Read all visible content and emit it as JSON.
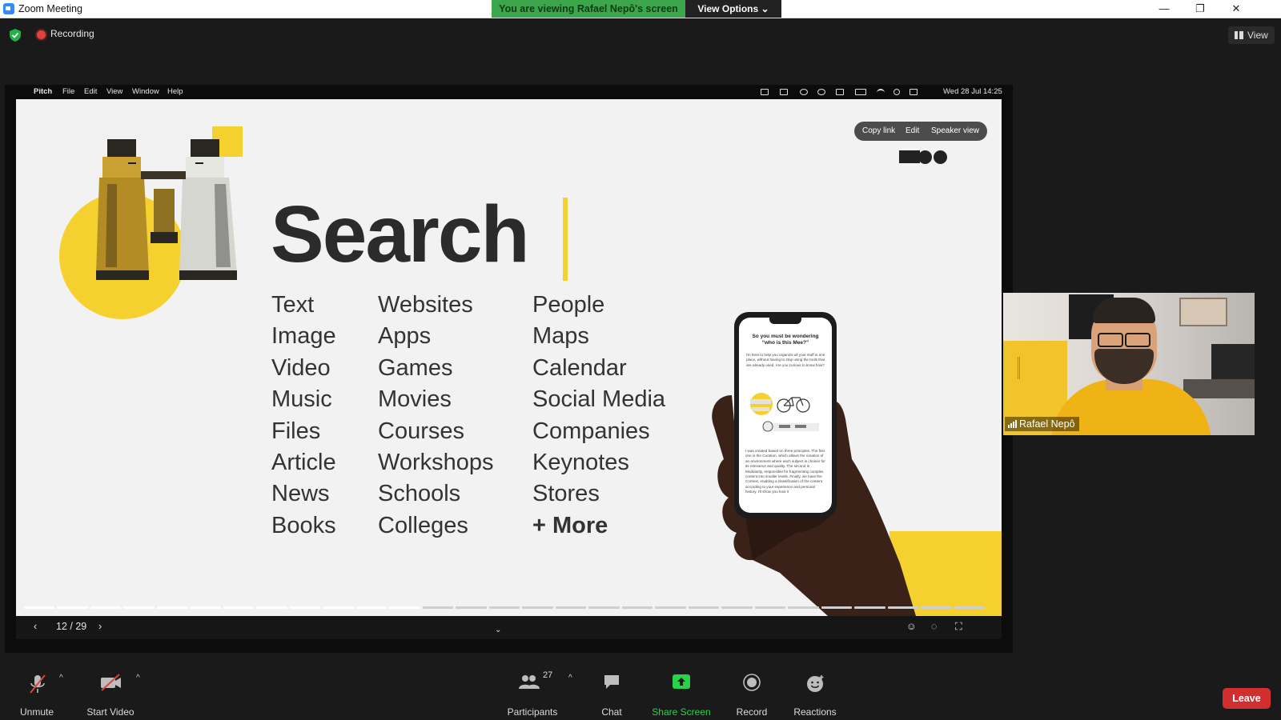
{
  "window": {
    "title": "Zoom Meeting",
    "banner_text": "You are viewing Rafael Nepô's screen",
    "view_options_label": "View Options",
    "minimize_glyph": "—",
    "restore_glyph": "❐",
    "close_glyph": "✕"
  },
  "meeting_bar": {
    "recording_label": "Recording",
    "view_label": "View"
  },
  "mac_menubar": {
    "app_name": "Pitch",
    "menus": [
      "File",
      "Edit",
      "View",
      "Window",
      "Help"
    ],
    "clock": "Wed 28 Jul  14:25"
  },
  "slide": {
    "heading": "Search",
    "columns": [
      [
        "Text",
        "Image",
        "Video",
        "Music",
        "Files",
        "Article",
        "News",
        "Books"
      ],
      [
        "Websites",
        "Apps",
        "Games",
        "Movies",
        "Courses",
        "Workshops",
        "Schools",
        "Colleges"
      ],
      [
        "People",
        "Maps",
        "Calendar",
        "Social Media",
        "Companies",
        "Keynotes",
        "Stores",
        "+ More"
      ]
    ],
    "pill": {
      "copy_link": "Copy link",
      "edit": "Edit",
      "speaker_view": "Speaker view"
    },
    "phone": {
      "title_line1": "So you must be wondering",
      "title_line2": "“who is this Mee?”",
      "intro": "I'm here to help you organize all your stuff in one place, without having to stop using the tools that are already used. Are you curious to know how?",
      "body": "I was created based on three principles. The first one is the Curation, which allows the creation of an environment where each subject is chosen for its relevance and quality. The second is Modularity, responsible for fragmenting complex content into smaller levels. Finally, we have the Context, enabling a classification of the content according to your experience and personal history. I'll show you how it"
    },
    "progress": {
      "current": 12,
      "total": 29
    },
    "page_counter": "12 / 29"
  },
  "speaker": {
    "name": "Rafael Nepô"
  },
  "toolbar": {
    "unmute": "Unmute",
    "start_video": "Start Video",
    "participants": "Participants",
    "participants_count": "27",
    "chat": "Chat",
    "share_screen": "Share Screen",
    "record": "Record",
    "reactions": "Reactions",
    "leave": "Leave"
  },
  "colors": {
    "brand_yellow": "#f5d130",
    "share_green": "#3ba64b",
    "leave_red": "#d12f2f",
    "zoom_blue": "#2d8cff"
  }
}
